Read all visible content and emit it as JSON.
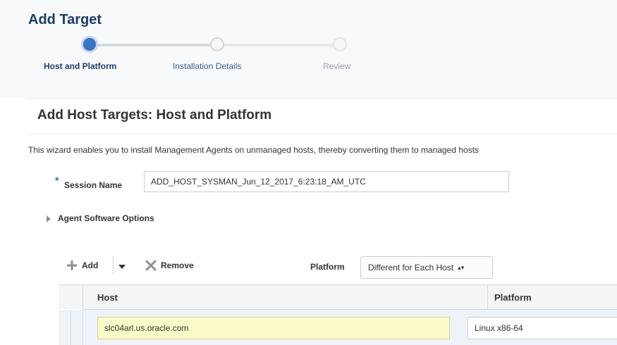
{
  "header": {
    "title": "Add Target"
  },
  "train": {
    "steps": [
      {
        "label": "Host and Platform",
        "state": "current"
      },
      {
        "label": "Installation Details",
        "state": "enabled"
      },
      {
        "label": "Review",
        "state": "disabled"
      }
    ]
  },
  "page": {
    "section_title": "Add Host Targets: Host and Platform",
    "description": "This wizard enables you to install Management Agents on unmanaged hosts, thereby converting them to managed hosts"
  },
  "session": {
    "required_mark": "*",
    "label": "Session Name",
    "value": "ADD_HOST_SYSMAN_Jun_12_2017_6:23:18_AM_UTC"
  },
  "agent_options": {
    "label": "Agent Software Options",
    "expanded": false
  },
  "toolbar": {
    "add_label": "Add",
    "remove_label": "Remove",
    "platform_label": "Platform",
    "platform_value": "Different for Each Host",
    "select_arrows": "▴▾"
  },
  "table": {
    "columns": [
      "Host",
      "Platform"
    ],
    "rows": [
      {
        "host": "slc04arl.us.oracle.com",
        "platform": "Linux x86-64"
      }
    ]
  },
  "colors": {
    "title": "#1c3d68",
    "accent": "#2b6cb0",
    "current_step": "#3b73c4",
    "required_field_bg": "#fbfbc9"
  },
  "icons": [
    "plus-icon",
    "chevron-down-icon",
    "remove-x-icon",
    "disclosure-triangle-icon",
    "select-arrows-icon"
  ]
}
